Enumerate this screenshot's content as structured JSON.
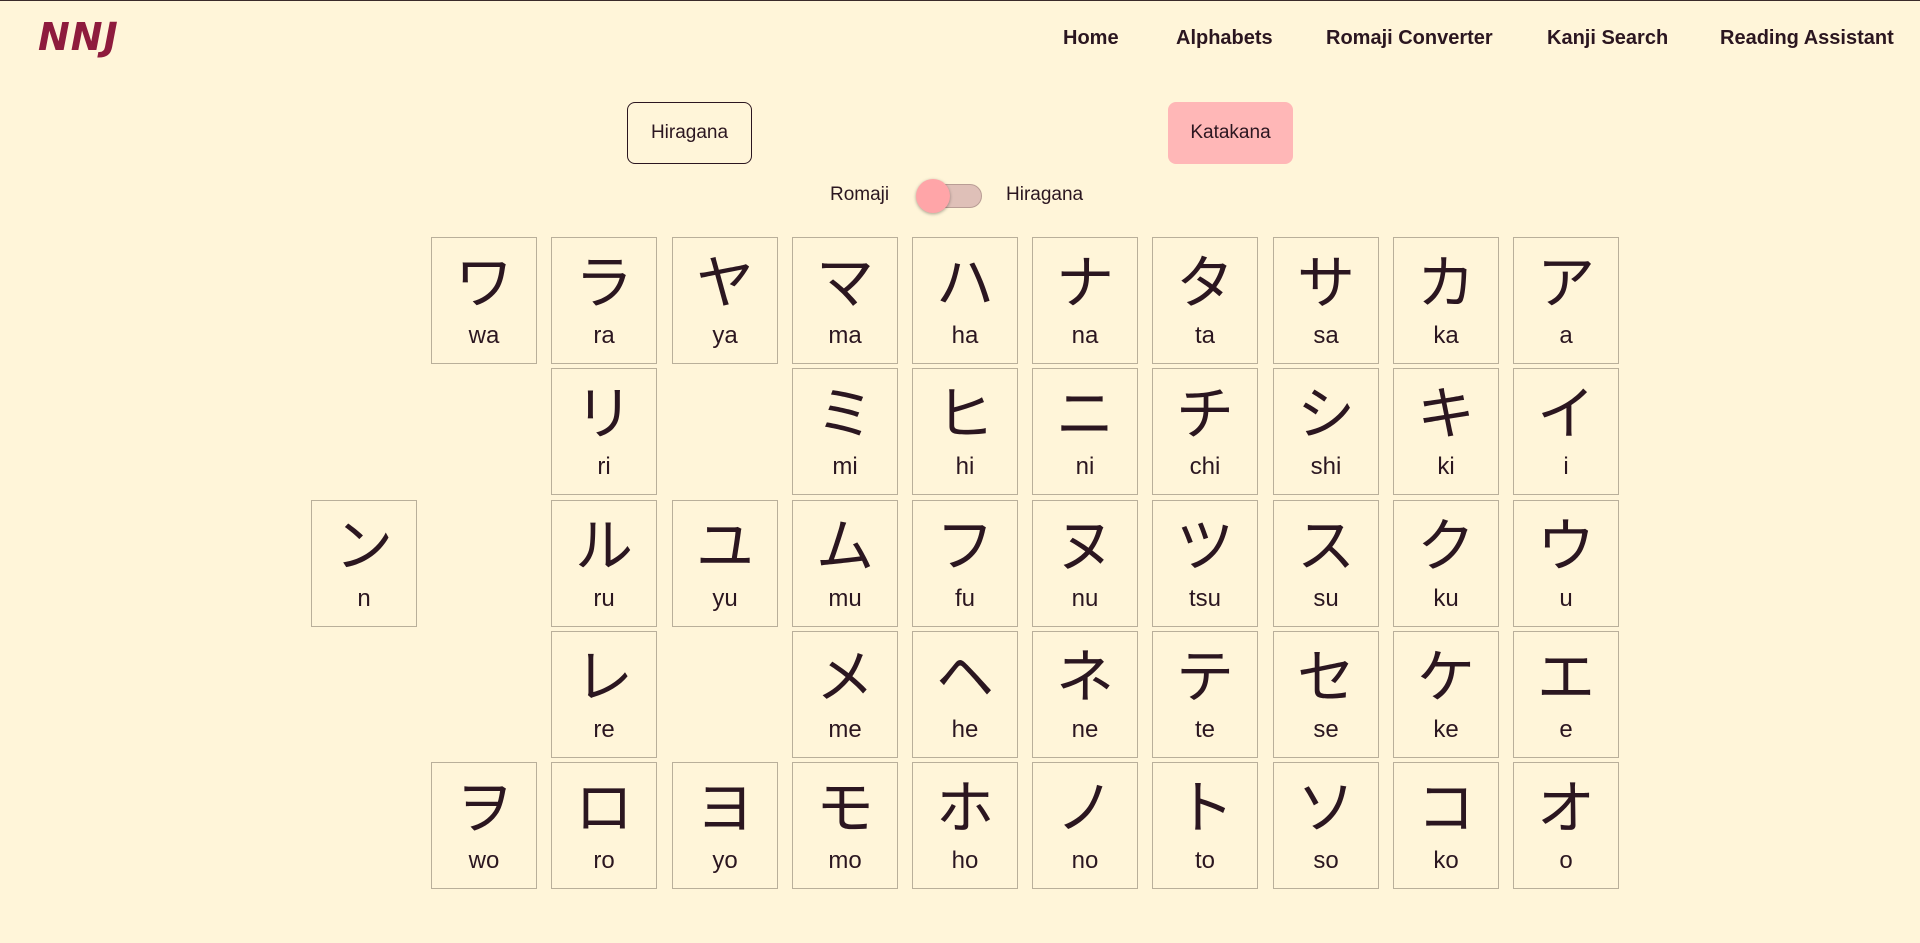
{
  "app": {
    "logo": "NNJ"
  },
  "nav": [
    {
      "label": "Home"
    },
    {
      "label": "Alphabets"
    },
    {
      "label": "Romaji Converter"
    },
    {
      "label": "Kanji Search"
    },
    {
      "label": "Reading Assistant"
    }
  ],
  "tabs": {
    "hiragana": "Hiragana",
    "katakana": "Katakana",
    "active": "Katakana"
  },
  "toggle": {
    "left_label": "Romaji",
    "right_label": "Hiragana",
    "state": "Romaji"
  },
  "colors": {
    "background": "#FFF5D9",
    "logo": "#8E1B3D",
    "active_tab": "#FFB7B7",
    "toggle_knob": "#FFA5A8",
    "text": "#2B1620"
  },
  "chart_rows_note": "",
  "columns": [
    {
      "cells": [
        null,
        null,
        {
          "kana": "ン",
          "romaji": "n"
        },
        null,
        null
      ]
    },
    {
      "cells": [
        {
          "kana": "ワ",
          "romaji": "wa"
        },
        null,
        null,
        null,
        {
          "kana": "ヲ",
          "romaji": "wo"
        }
      ]
    },
    {
      "cells": [
        {
          "kana": "ラ",
          "romaji": "ra"
        },
        {
          "kana": "リ",
          "romaji": "ri"
        },
        {
          "kana": "ル",
          "romaji": "ru"
        },
        {
          "kana": "レ",
          "romaji": "re"
        },
        {
          "kana": "ロ",
          "romaji": "ro"
        }
      ]
    },
    {
      "cells": [
        {
          "kana": "ヤ",
          "romaji": "ya"
        },
        null,
        {
          "kana": "ユ",
          "romaji": "yu"
        },
        null,
        {
          "kana": "ヨ",
          "romaji": "yo"
        }
      ]
    },
    {
      "cells": [
        {
          "kana": "マ",
          "romaji": "ma"
        },
        {
          "kana": "ミ",
          "romaji": "mi"
        },
        {
          "kana": "ム",
          "romaji": "mu"
        },
        {
          "kana": "メ",
          "romaji": "me"
        },
        {
          "kana": "モ",
          "romaji": "mo"
        }
      ]
    },
    {
      "cells": [
        {
          "kana": "ハ",
          "romaji": "ha"
        },
        {
          "kana": "ヒ",
          "romaji": "hi"
        },
        {
          "kana": "フ",
          "romaji": "fu"
        },
        {
          "kana": "ヘ",
          "romaji": "he"
        },
        {
          "kana": "ホ",
          "romaji": "ho"
        }
      ]
    },
    {
      "cells": [
        {
          "kana": "ナ",
          "romaji": "na"
        },
        {
          "kana": "ニ",
          "romaji": "ni"
        },
        {
          "kana": "ヌ",
          "romaji": "nu"
        },
        {
          "kana": "ネ",
          "romaji": "ne"
        },
        {
          "kana": "ノ",
          "romaji": "no"
        }
      ]
    },
    {
      "cells": [
        {
          "kana": "タ",
          "romaji": "ta"
        },
        {
          "kana": "チ",
          "romaji": "chi"
        },
        {
          "kana": "ツ",
          "romaji": "tsu"
        },
        {
          "kana": "テ",
          "romaji": "te"
        },
        {
          "kana": "ト",
          "romaji": "to"
        }
      ]
    },
    {
      "cells": [
        {
          "kana": "サ",
          "romaji": "sa"
        },
        {
          "kana": "シ",
          "romaji": "shi"
        },
        {
          "kana": "ス",
          "romaji": "su"
        },
        {
          "kana": "セ",
          "romaji": "se"
        },
        {
          "kana": "ソ",
          "romaji": "so"
        }
      ]
    },
    {
      "cells": [
        {
          "kana": "カ",
          "romaji": "ka"
        },
        {
          "kana": "キ",
          "romaji": "ki"
        },
        {
          "kana": "ク",
          "romaji": "ku"
        },
        {
          "kana": "ケ",
          "romaji": "ke"
        },
        {
          "kana": "コ",
          "romaji": "ko"
        }
      ]
    },
    {
      "cells": [
        {
          "kana": "ア",
          "romaji": "a"
        },
        {
          "kana": "イ",
          "romaji": "i"
        },
        {
          "kana": "ウ",
          "romaji": "u"
        },
        {
          "kana": "エ",
          "romaji": "e"
        },
        {
          "kana": "オ",
          "romaji": "o"
        }
      ]
    }
  ]
}
